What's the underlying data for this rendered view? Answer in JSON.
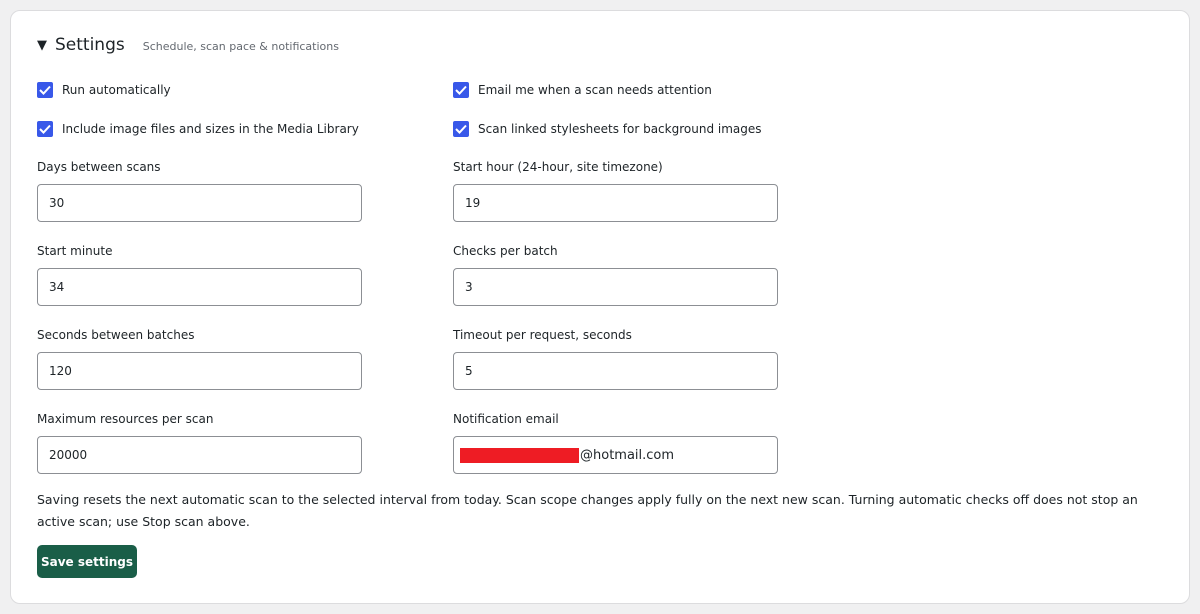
{
  "header": {
    "caret": "▼",
    "title": "Settings",
    "subtitle": "Schedule, scan pace & notifications"
  },
  "checkboxes": [
    {
      "label": "Run automatically",
      "checked": true
    },
    {
      "label": "Email me when a scan needs attention",
      "checked": true
    },
    {
      "label": "Include image files and sizes in the Media Library",
      "checked": true
    },
    {
      "label": "Scan linked stylesheets for background images",
      "checked": true
    }
  ],
  "fields": {
    "days_between_scans": {
      "label": "Days between scans",
      "value": "30"
    },
    "start_hour": {
      "label": "Start hour (24-hour, site timezone)",
      "value": "19"
    },
    "start_minute": {
      "label": "Start minute",
      "value": "34"
    },
    "checks_per_batch": {
      "label": "Checks per batch",
      "value": "3"
    },
    "seconds_between_batches": {
      "label": "Seconds between batches",
      "value": "120"
    },
    "timeout_per_request": {
      "label": "Timeout per request, seconds",
      "value": "5"
    },
    "max_resources": {
      "label": "Maximum resources per scan",
      "value": "20000"
    },
    "notification_email": {
      "label": "Notification email",
      "value_visible_suffix": "@hotmail.com"
    }
  },
  "note": "Saving resets the next automatic scan to the selected interval from today. Scan scope changes apply fully on the next new scan. Turning automatic checks off does not stop an active scan; use Stop scan above.",
  "save_button": {
    "label": "Save settings"
  },
  "colors": {
    "checkbox": "#3858e9",
    "button": "#1a5e48",
    "redaction": "#ee1c24"
  }
}
